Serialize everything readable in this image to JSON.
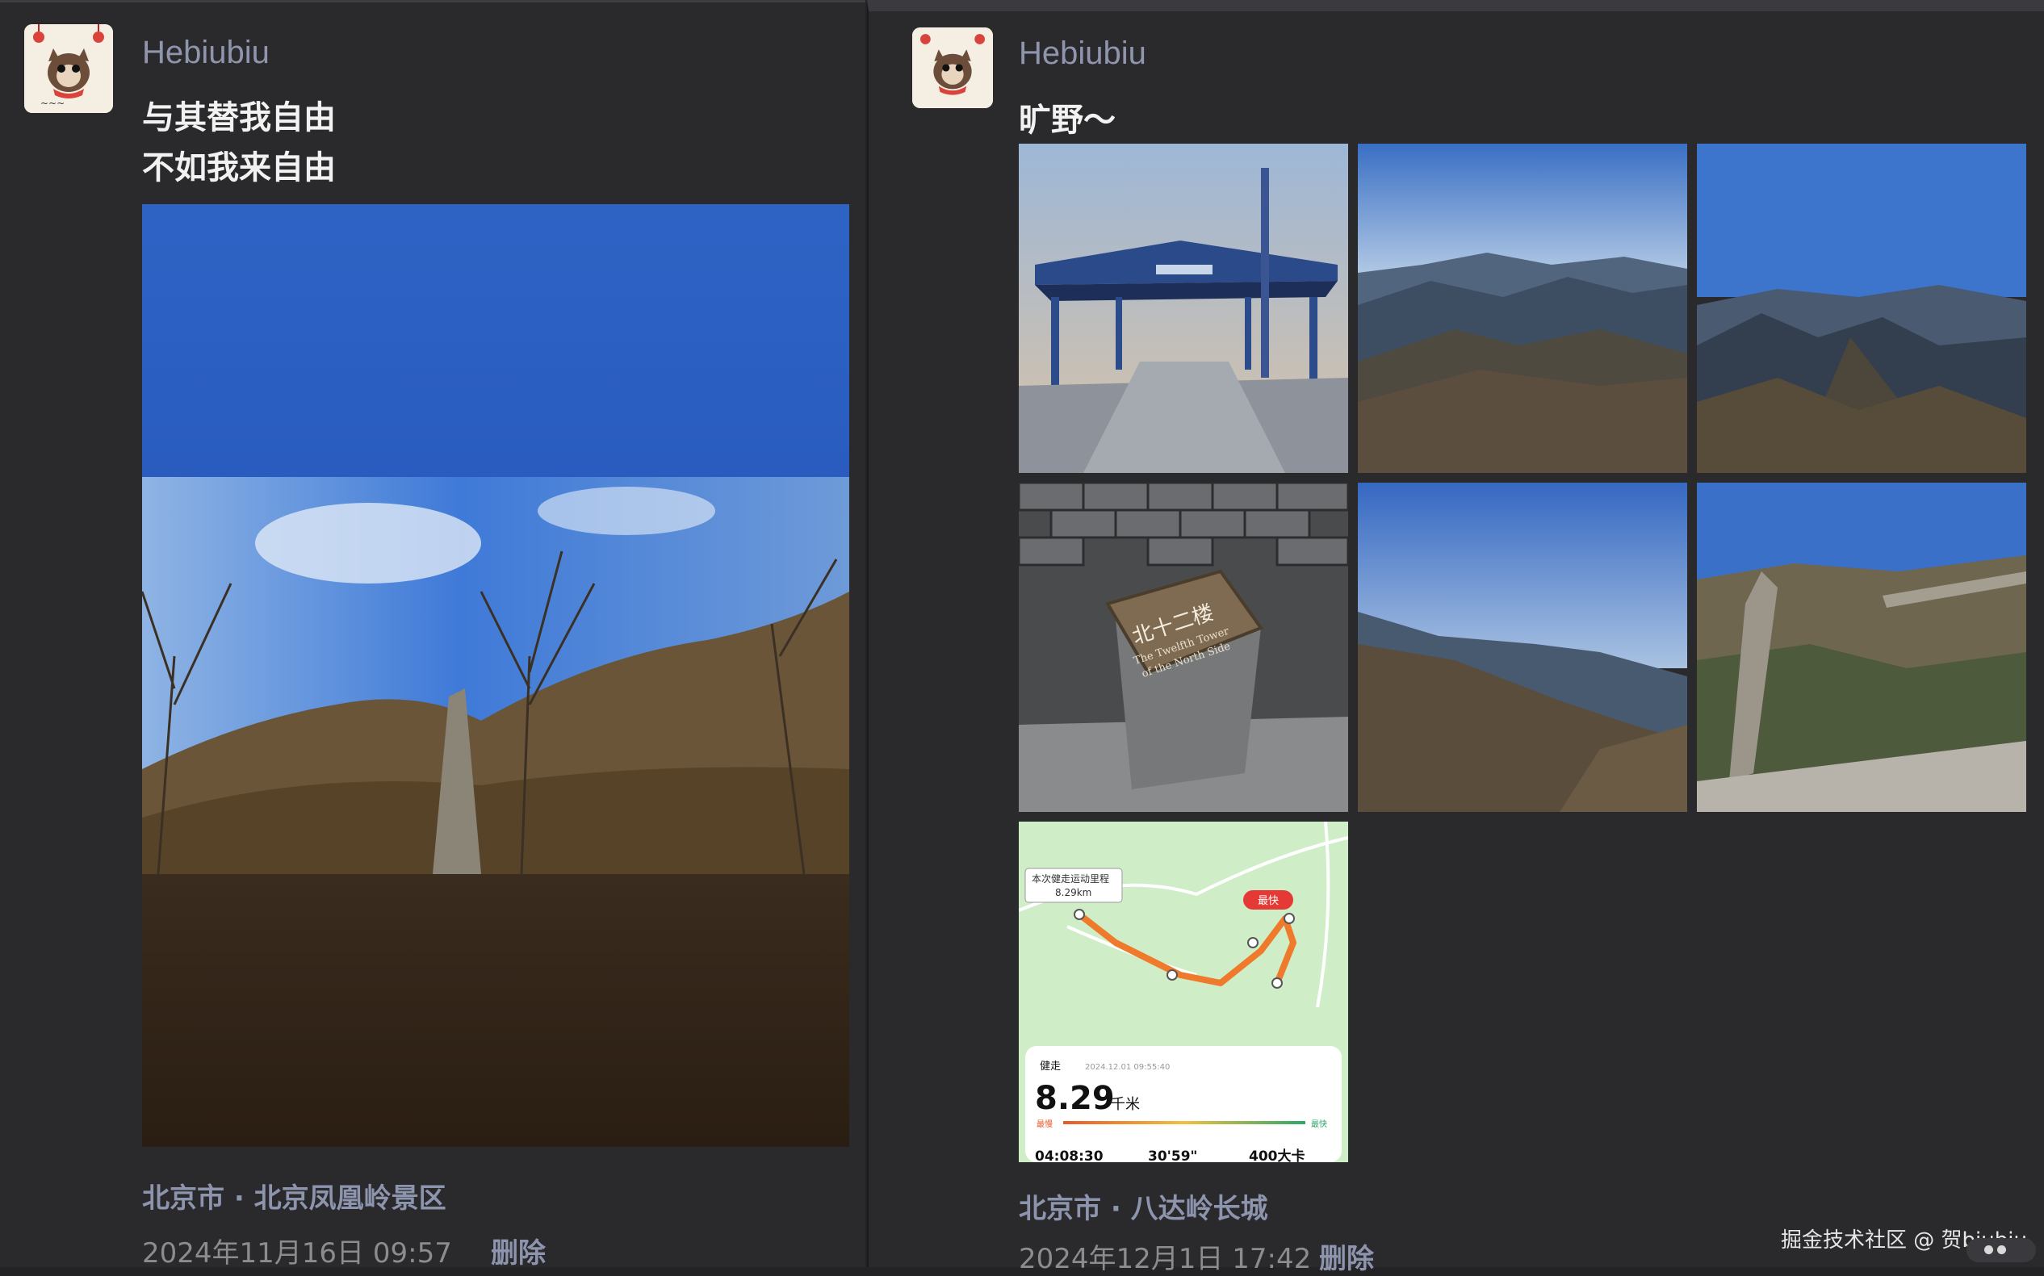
{
  "posts": [
    {
      "username": "Hebiubiu",
      "text_lines": [
        "与其替我自由",
        "不如我来自由"
      ],
      "location": "北京市 · 北京凤凰岭景区",
      "time": "2024年11月16日 09:57",
      "delete_label": "删除"
    },
    {
      "username": "Hebiubiu",
      "text_lines": [
        "旷野～"
      ],
      "location": "北京市 · 八达岭长城",
      "time": "2024年12月1日 17:42",
      "delete_label": "删除",
      "sign_text": "北十二楼",
      "sign_subtext_1": "The Twelfth Tower",
      "sign_subtext_2": "of the North Side",
      "map": {
        "callout_title": "本次健走运动里程",
        "callout_value": "8.29km",
        "fast_badge": "最快",
        "activity": "健走",
        "datetime": "2024.12.01 09:55:40",
        "distance": "8.29",
        "unit": "千米",
        "slow_label": "最慢",
        "fast_label": "最快",
        "stat_1": "04:08:30",
        "stat_2": "30'59\"",
        "stat_3": "400大卡"
      }
    }
  ],
  "watermark": "掘金技术社区 @ 贺biubiu",
  "colors": {
    "panel_bg": "#2a2a2c",
    "name": "#8f95ad",
    "text": "#f2f2f2",
    "meta": "#8c8c90"
  }
}
